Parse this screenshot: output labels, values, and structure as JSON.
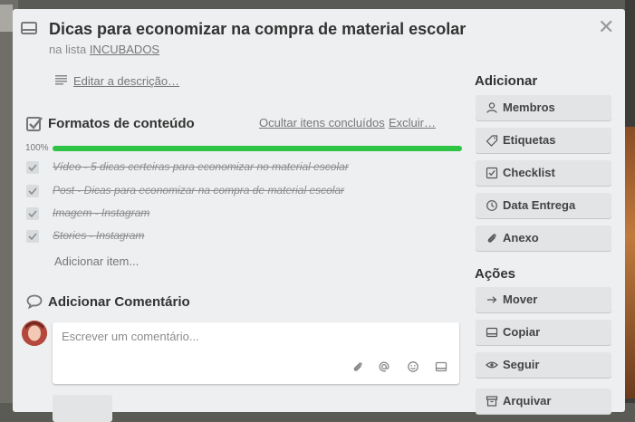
{
  "card": {
    "title": "Dicas para economizar na compra de material escolar",
    "list_prefix": "na lista ",
    "list_name": "INCUBADOS",
    "edit_description": "Editar a descrição…"
  },
  "checklist": {
    "title": "Formatos de conteúdo",
    "hide_checked": "Ocultar itens concluídos",
    "delete": "Excluir…",
    "progress_label": "100%",
    "progress": 1.0,
    "progress_color": "#2ec344",
    "items": [
      {
        "text": "Vídeo - 5 dicas certeiras para economizar no material escolar",
        "checked": true
      },
      {
        "text": "Post - Dicas para economizar na compra de material escolar",
        "checked": true
      },
      {
        "text": "Imagem - Instagram",
        "checked": true
      },
      {
        "text": "Stories - Instagram",
        "checked": true
      }
    ],
    "add_item": "Adicionar item..."
  },
  "comment": {
    "title": "Adicionar Comentário",
    "placeholder": "Escrever um comentário...",
    "icons": [
      "paperclip-icon",
      "mention-icon",
      "emoji-icon",
      "card-icon"
    ]
  },
  "sidebar": {
    "add_title": "Adicionar",
    "add_buttons": [
      {
        "label": "Membros",
        "icon": "person-icon"
      },
      {
        "label": "Etiquetas",
        "icon": "tag-icon"
      },
      {
        "label": "Checklist",
        "icon": "checkbox-icon"
      },
      {
        "label": "Data Entrega",
        "icon": "clock-icon"
      },
      {
        "label": "Anexo",
        "icon": "paperclip-icon"
      }
    ],
    "actions_title": "Ações",
    "action_buttons": [
      {
        "label": "Mover",
        "icon": "arrow-right-icon"
      },
      {
        "label": "Copiar",
        "icon": "copy-icon"
      },
      {
        "label": "Seguir",
        "icon": "eye-icon"
      },
      {
        "label": "Arquivar",
        "icon": "archive-icon"
      }
    ]
  }
}
